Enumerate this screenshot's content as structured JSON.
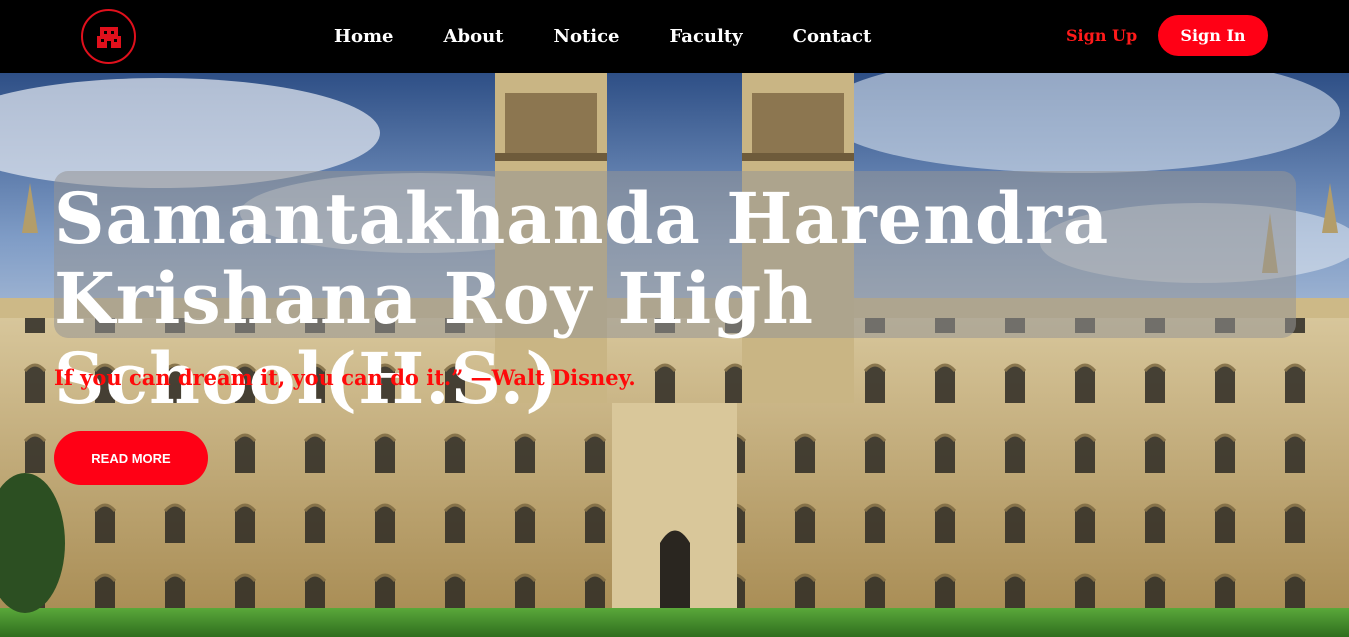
{
  "nav": {
    "logo_icon": "school-building-icon",
    "links": [
      "Home",
      "About",
      "Notice",
      "Faculty",
      "Contact"
    ],
    "signup_label": "Sign Up",
    "signin_label": "Sign In"
  },
  "hero": {
    "title": "Samantakhanda Harendra Krishana Roy High School(H.S.)",
    "quote": "If you can dream it, you can do it.” —Walt Disney.",
    "read_more_label": "READ MORE",
    "background": "college-building-painting"
  },
  "colors": {
    "accent": "#ff0015",
    "nav_bg": "#000000",
    "sky": "#5f7fb0",
    "stone": "#c9b27d",
    "lawn": "#3f8a2a"
  }
}
